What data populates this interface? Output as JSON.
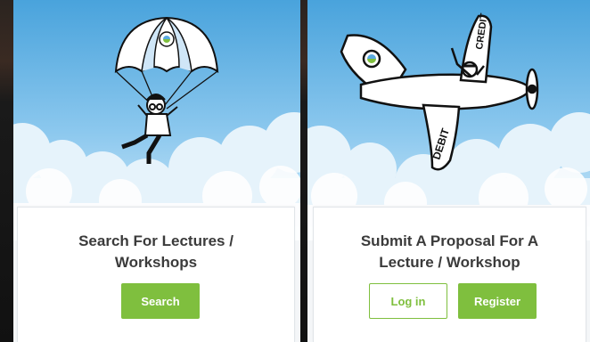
{
  "cards": [
    {
      "title": "Search For Lectures /\nWorkshops",
      "buttons": [
        "Search"
      ]
    },
    {
      "title": "Submit A Proposal For A\nLecture / Workshop",
      "buttons": [
        "Log in",
        "Register"
      ]
    }
  ],
  "plane": {
    "wing_label": "DEBIT",
    "tail_label": "CREDIT"
  },
  "colors": {
    "accent": "#7fbf3e",
    "sky_top": "#4fa8e0",
    "sky_bottom": "#cfe8f8",
    "title_text": "#3b3b3b"
  }
}
